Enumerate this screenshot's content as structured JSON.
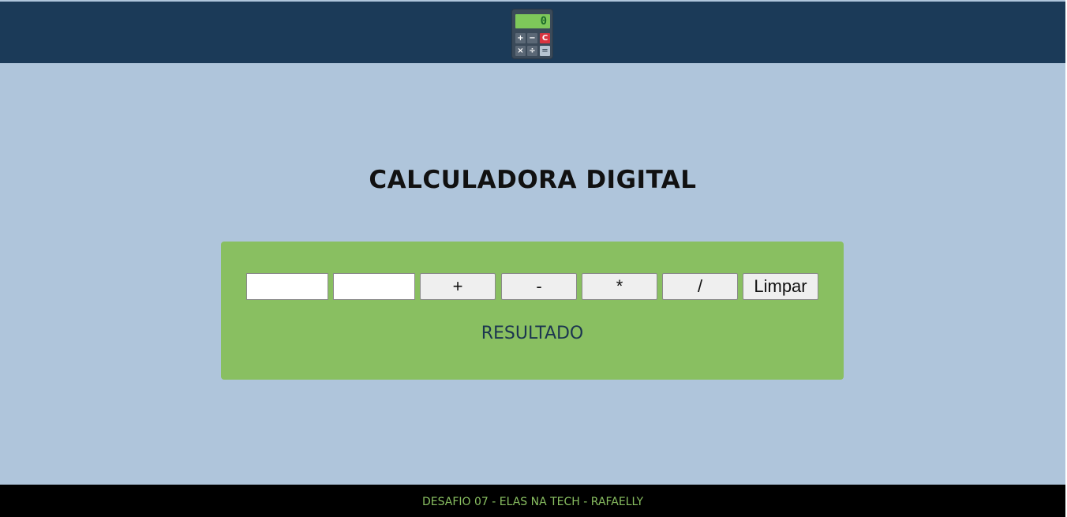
{
  "header": {
    "logo": {
      "icon": "calculator-icon",
      "screen_value": "0",
      "keys": [
        "+",
        "−",
        "C",
        "×",
        "÷",
        "="
      ],
      "colors": {
        "screen": "#7ec85a",
        "clear_key": "#d9343f",
        "body": "#3b4a59"
      }
    }
  },
  "main": {
    "title": "CALCULADORA DIGITAL",
    "calculator": {
      "input1": {
        "value": "",
        "placeholder": ""
      },
      "input2": {
        "value": "",
        "placeholder": ""
      },
      "buttons": {
        "add": "+",
        "subtract": "-",
        "multiply": "*",
        "divide": "/",
        "clear": "Limpar"
      },
      "result": "RESULTADO"
    }
  },
  "footer": {
    "text": "DESAFIO 07 - ELAS NA TECH - RAFAELLY"
  },
  "colors": {
    "header_bg": "#1b3a58",
    "page_bg": "#afc5db",
    "panel_bg": "#89bf61",
    "footer_bg": "#000000",
    "footer_text": "#89bf61"
  }
}
